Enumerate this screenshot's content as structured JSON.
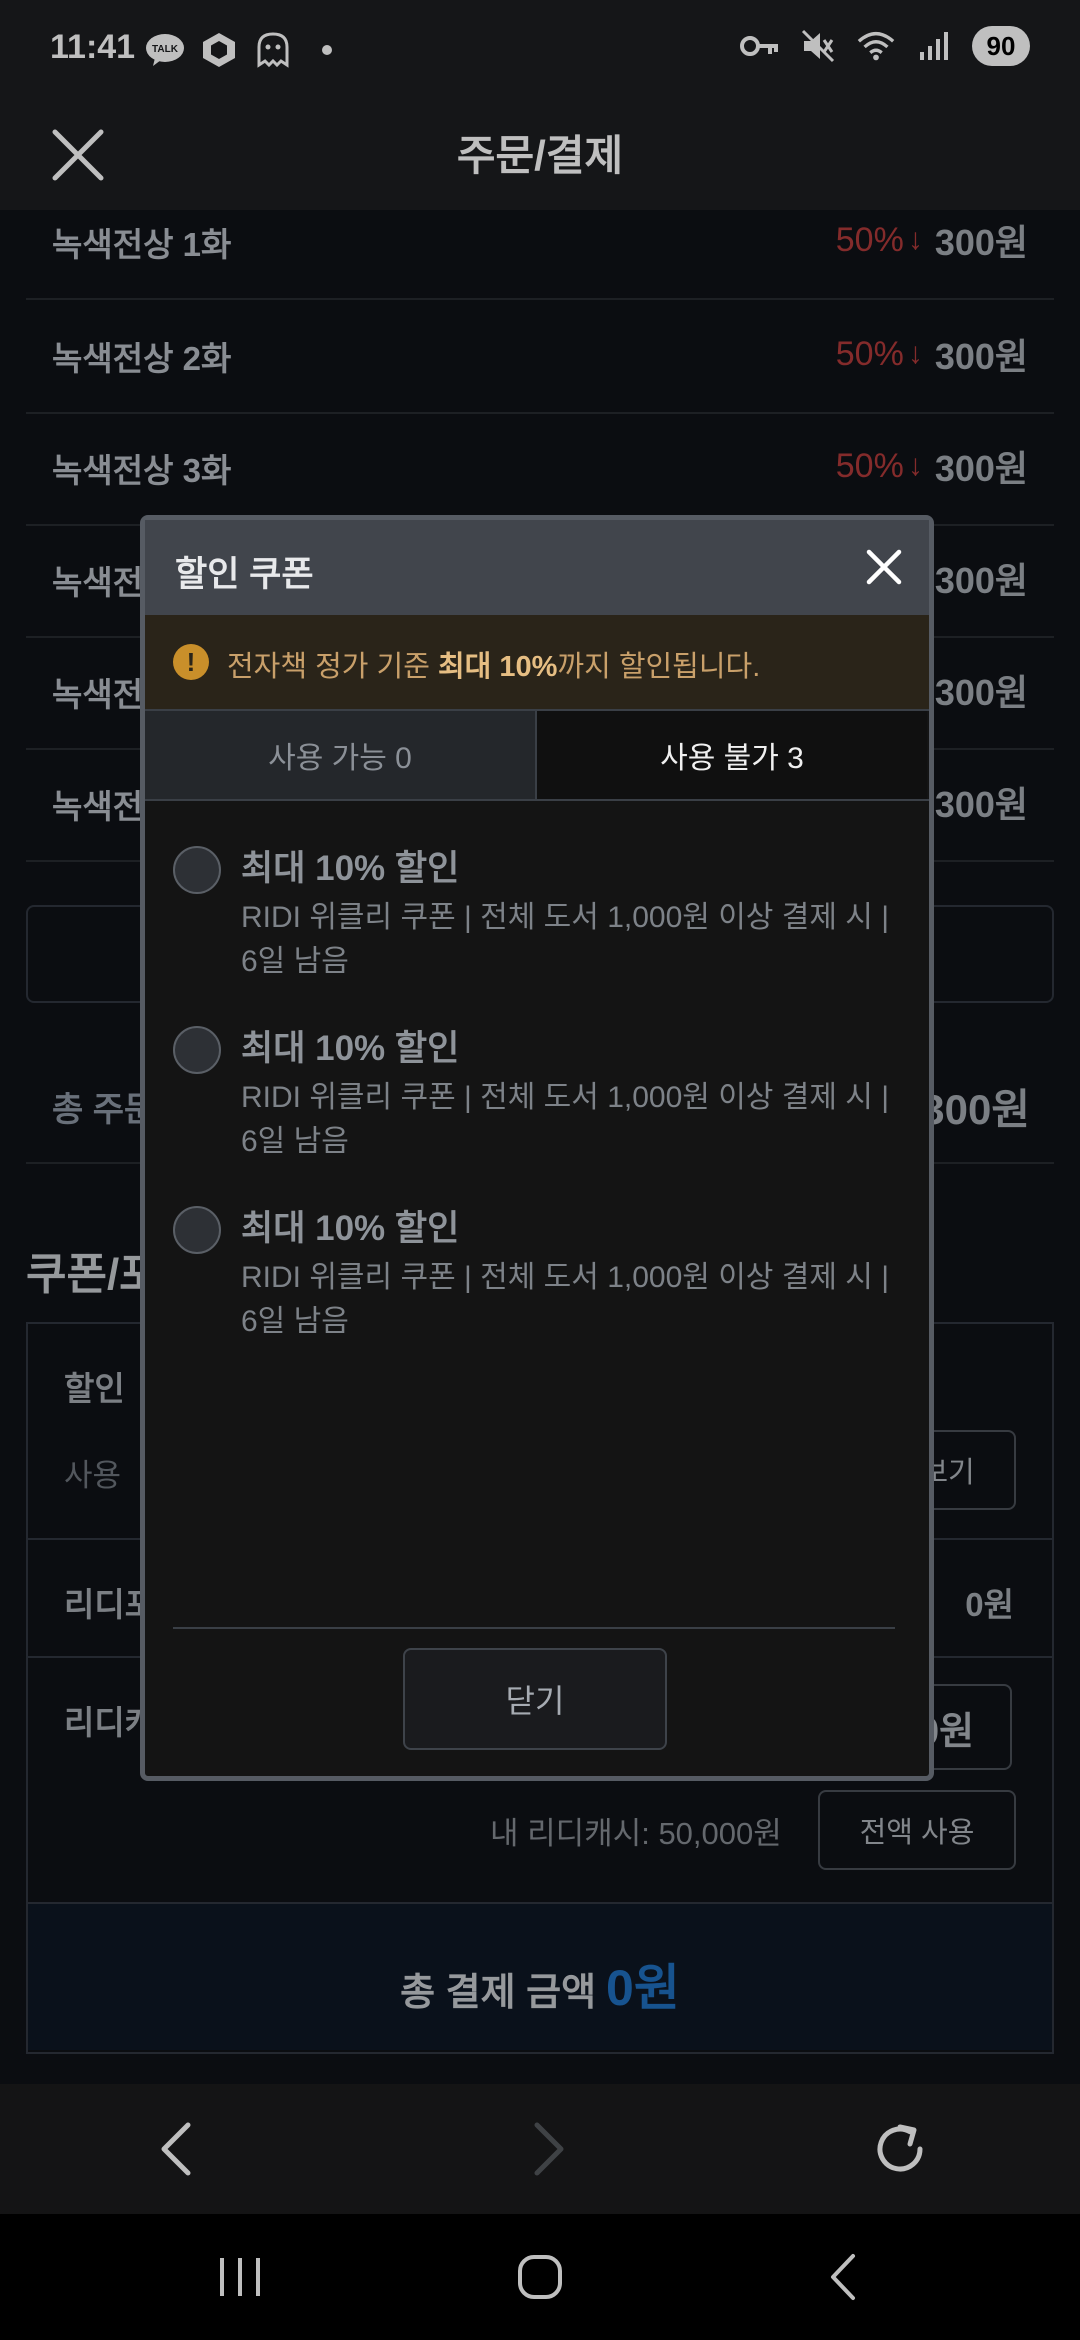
{
  "status_bar": {
    "time": "11:41",
    "left_icons": [
      "kakaotalk-icon",
      "cube-icon",
      "ghost-icon",
      "dot-icon"
    ],
    "right_icons": [
      "key-icon",
      "mute-icon",
      "wifi-icon",
      "signal-icon"
    ],
    "battery": "90"
  },
  "header": {
    "title": "주문/결제",
    "close_icon": "close-icon"
  },
  "items": [
    {
      "name": "녹색전상 1화",
      "discount": "50%",
      "price": "300원"
    },
    {
      "name": "녹색전상 2화",
      "discount": "50%",
      "price": "300원"
    },
    {
      "name": "녹색전상 3화",
      "discount": "50%",
      "price": "300원"
    },
    {
      "name": "녹색전",
      "discount": "",
      "price": "300원"
    },
    {
      "name": "녹색전",
      "discount": "",
      "price": "300원"
    },
    {
      "name": "녹색전",
      "discount": "",
      "price": "300원"
    }
  ],
  "background": {
    "total_order_label": "총 주문",
    "total_order_value": "300원",
    "coupon_section_title": "쿠폰/포",
    "discount_label": "할인",
    "usage_label": "사용",
    "view_button": "보기",
    "ridi_point_label": "리디포",
    "ridi_point_value": "0원",
    "ridi_cash_label": "리디캐",
    "ridi_cash_input": "0원",
    "my_cash": "내 리디캐시: 50,000원",
    "use_all_button": "전액 사용",
    "total_payment_label": "총 결제 금액",
    "total_payment_value": "0원"
  },
  "modal": {
    "title": "할인 쿠폰",
    "notice_prefix": "전자책 정가 기준 ",
    "notice_bold": "최대 10%",
    "notice_suffix": "까지 할인됩니다.",
    "tabs": [
      {
        "label": "사용 가능 0",
        "active": false
      },
      {
        "label": "사용 불가 3",
        "active": true
      }
    ],
    "coupons": [
      {
        "title": "최대 10% 할인",
        "description": "RIDI 위클리 쿠폰 | 전체 도서 1,000원 이상 결제 시 | 6일 남음"
      },
      {
        "title": "최대 10% 할인",
        "description": "RIDI 위클리 쿠폰 | 전체 도서 1,000원 이상 결제 시 | 6일 남음"
      },
      {
        "title": "최대 10% 할인",
        "description": "RIDI 위클리 쿠폰 | 전체 도서 1,000원 이상 결제 시 | 6일 남음"
      }
    ],
    "close_button": "닫기"
  },
  "browser_nav": [
    "back-icon",
    "forward-icon",
    "refresh-icon"
  ],
  "system_nav": [
    "recents-icon",
    "home-icon",
    "back-icon"
  ],
  "colors": {
    "discount_red": "#b03a3a",
    "total_blue": "#1f6fbf",
    "notice_gold": "#c98f2a"
  }
}
